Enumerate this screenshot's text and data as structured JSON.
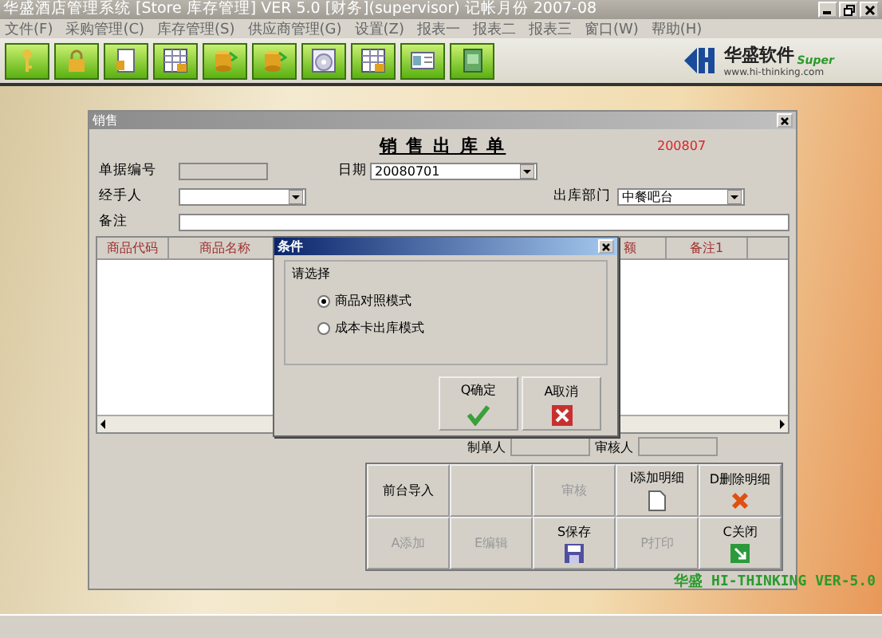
{
  "window": {
    "title": "华盛酒店管理系统 [Store 库存管理] VER 5.0 [财务](supervisor) 记帐月份 2007-08"
  },
  "menu": [
    "文件(F)",
    "采购管理(C)",
    "库存管理(S)",
    "供应商管理(G)",
    "设置(Z)",
    "报表一",
    "报表二",
    "报表三",
    "窗口(W)",
    "帮助(H)"
  ],
  "logo": {
    "name": "华盛软件",
    "tag": "Super",
    "url": "www.hi-thinking.com"
  },
  "document_window": {
    "title": "销售",
    "heading": "销 售 出 库 单",
    "period": "200807",
    "fields": [
      {
        "label": "单据编号",
        "kind": "text",
        "disabled": true
      },
      {
        "label": "日期",
        "kind": "dropdown",
        "value": "20080701"
      },
      {
        "label": "经手人",
        "kind": "dropdown"
      },
      {
        "label": "出库部门",
        "kind": "dropdown",
        "value": "中餐吧台"
      },
      {
        "label": "备注",
        "kind": "text",
        "disabled": false
      }
    ],
    "table": {
      "columns": [
        "商品代码",
        "商品名称",
        "额",
        "备注1"
      ]
    },
    "signatures": [
      "制单人",
      "审核人"
    ],
    "buttons": [
      {
        "label": "前台导入",
        "disabled": false
      },
      {
        "kind": "blank"
      },
      {
        "label": "审核",
        "disabled": true
      },
      {
        "label": "I添加明细",
        "kind": "new",
        "disabled": false
      },
      {
        "label": "D删除明细",
        "kind": "delete",
        "disabled": false
      },
      {
        "label": "A添加",
        "disabled": true
      },
      {
        "label": "E编辑",
        "disabled": true
      },
      {
        "label": "S保存",
        "kind": "save",
        "disabled": false
      },
      {
        "label": "P打印",
        "disabled": true
      },
      {
        "label": "C关闭",
        "kind": "close",
        "disabled": false
      }
    ]
  },
  "dialog": {
    "title": "条件",
    "group": "请选择",
    "options": [
      {
        "label": "商品对照模式",
        "selected": true
      },
      {
        "label": "成本卡出库模式",
        "selected": false
      }
    ],
    "buttons": [
      {
        "label": "Q确定",
        "kind": "ok"
      },
      {
        "label": "A取消",
        "kind": "cancel"
      }
    ]
  },
  "footer_text": "华盛 HI-THINKING VER-5.0"
}
